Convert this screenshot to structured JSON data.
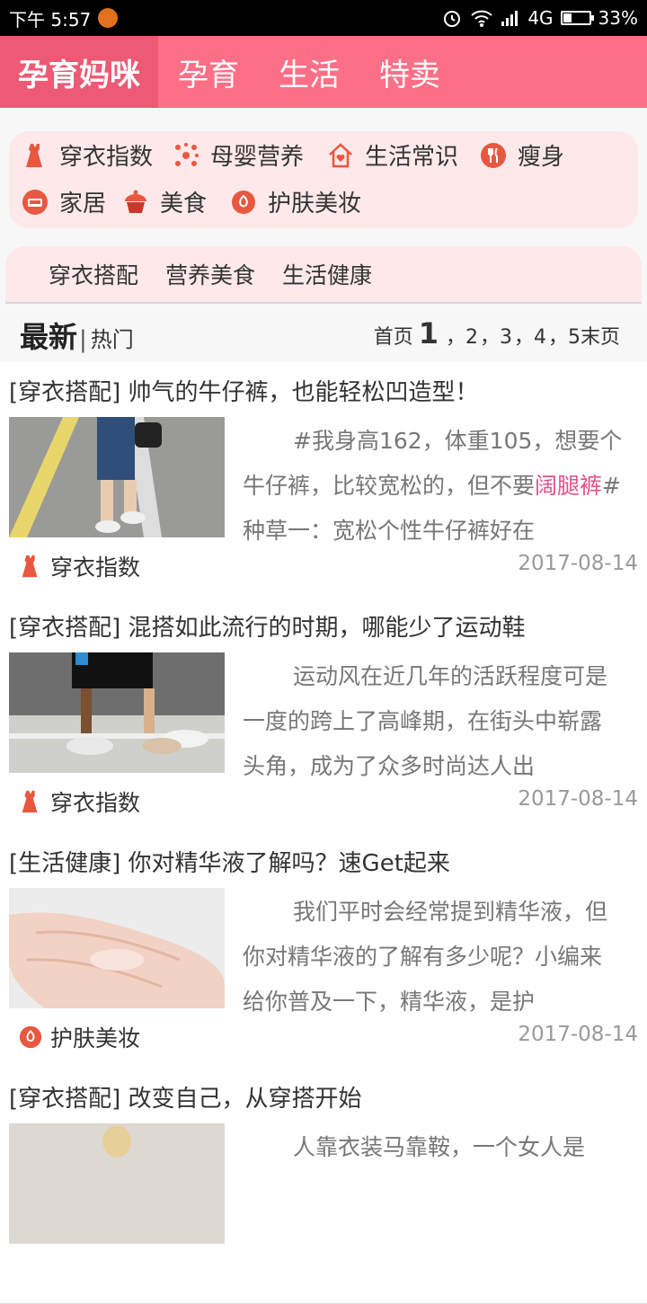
{
  "status_bar": {
    "time": "下午 5:57",
    "network": "4G",
    "battery": "33%",
    "battery_level": 0.33
  },
  "nav": {
    "tabs": [
      "孕育妈咪",
      "孕育",
      "生活",
      "特卖"
    ]
  },
  "categories": [
    {
      "label": "穿衣指数",
      "icon": "dress-icon"
    },
    {
      "label": "母婴营养",
      "icon": "dots-icon"
    },
    {
      "label": "生活常识",
      "icon": "house-icon"
    },
    {
      "label": "瘦身",
      "icon": "fork-knife-icon"
    },
    {
      "label": "家居",
      "icon": "sofa-icon"
    },
    {
      "label": "美食",
      "icon": "cupcake-icon"
    },
    {
      "label": "护肤美妆",
      "icon": "cosmetics-icon"
    }
  ],
  "subtabs": [
    "穿衣搭配",
    "营养美食",
    "生活健康"
  ],
  "list_head": {
    "latest": "最新",
    "sep": "|",
    "hot": "热门"
  },
  "pager": {
    "first": "首页",
    "current": "1",
    "pages": [
      "，2",
      "，3",
      "，4",
      "，5"
    ],
    "last": "末页"
  },
  "articles": [
    {
      "title": "[穿衣搭配] 帅气的牛仔裤，也能轻松凹造型！",
      "desc_a": "#我身高162，体重105，想要个牛仔裤，比较宽松的，但不要",
      "desc_hl": "阔腿裤",
      "desc_b": "#种草一：宽松个性牛仔裤好在",
      "tag": "穿衣指数",
      "tag_icon": "dress-icon",
      "date": "2017-08-14"
    },
    {
      "title": "[穿衣搭配] 混搭如此流行的时期，哪能少了运动鞋",
      "desc_a": "运动风在近几年的活跃程度可是一度的跨上了高峰期，在街头中崭露头角，成为了众多时尚达人出",
      "desc_hl": "",
      "desc_b": "",
      "tag": "穿衣指数",
      "tag_icon": "dress-icon",
      "date": "2017-08-14"
    },
    {
      "title": "[生活健康] 你对精华液了解吗？速Get起来",
      "desc_a": "我们平时会经常提到精华液，但你对精华液的了解有多少呢？小编来给你普及一下，精华液，是护",
      "desc_hl": "",
      "desc_b": "",
      "tag": "护肤美妆",
      "tag_icon": "cosmetics-icon",
      "date": "2017-08-14"
    },
    {
      "title": "[穿衣搭配] 改变自己，从穿搭开始",
      "desc_a": "人靠衣装马靠鞍，一个女人是",
      "desc_hl": "",
      "desc_b": "",
      "tag": "",
      "tag_icon": "",
      "date": ""
    }
  ],
  "colors": {
    "brand": "#fd6f86",
    "brand_active": "#ec5a76",
    "panel": "#fde8ea",
    "icon": "#e8573f",
    "highlight": "#e6508a"
  }
}
